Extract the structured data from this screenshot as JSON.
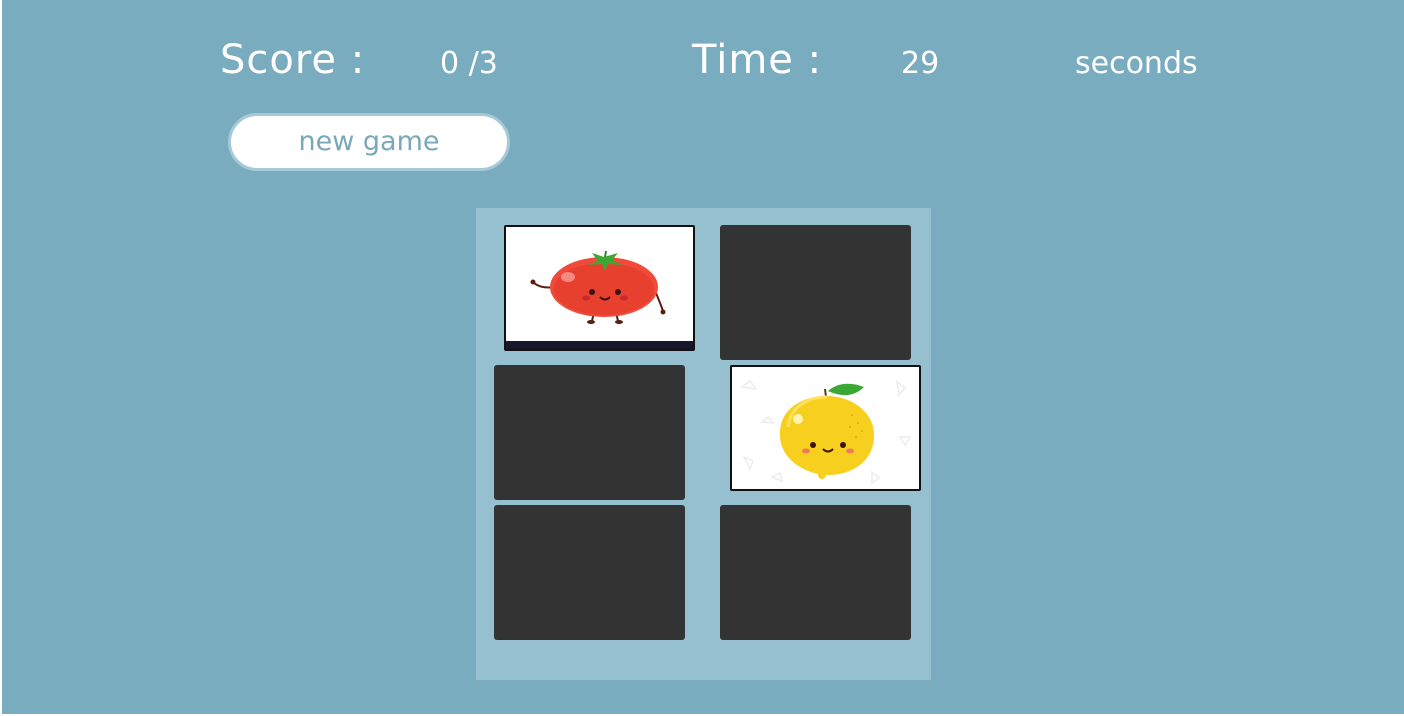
{
  "score": {
    "label": "Score :",
    "value": "0 /3"
  },
  "time": {
    "label": "Time :",
    "value": "29",
    "unit": "seconds"
  },
  "new_game_label": "new game",
  "colors": {
    "background": "#79acbf",
    "board": "#96bfcf",
    "card_back": "#333333",
    "button_text": "#7aa8bb"
  },
  "cards": [
    {
      "state": "face-up",
      "image": "tomato-icon"
    },
    {
      "state": "face-down"
    },
    {
      "state": "face-down"
    },
    {
      "state": "face-up",
      "image": "lemon-icon"
    },
    {
      "state": "face-down"
    },
    {
      "state": "face-down"
    }
  ]
}
